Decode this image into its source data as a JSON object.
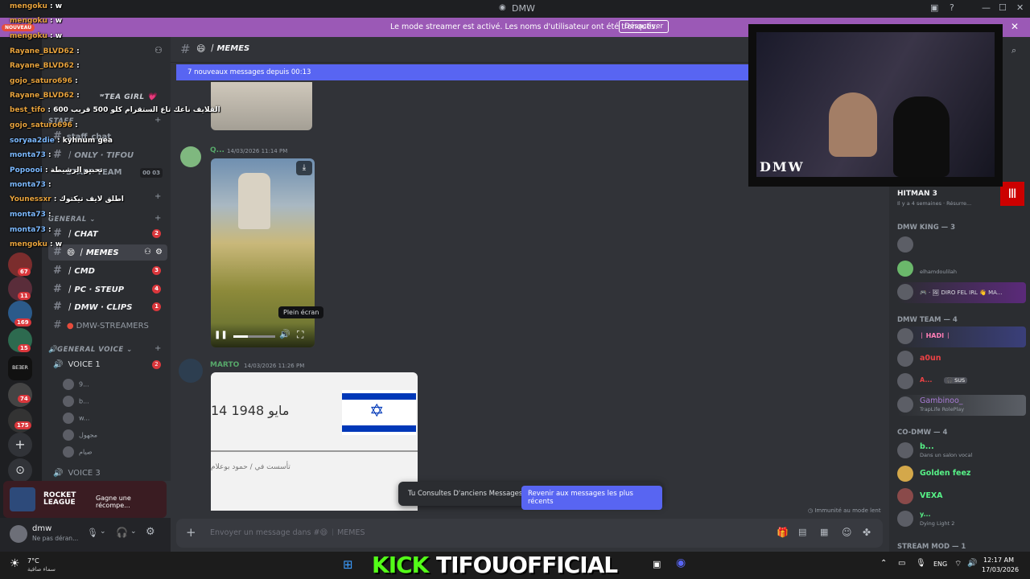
{
  "window": {
    "title": "DMW"
  },
  "banner": {
    "message": "Le mode streamer est activé. Les noms d'utilisateur ont été tronqués.",
    "button": "Désactiver",
    "nouveau": "NOUVEAU"
  },
  "channel": {
    "name": "ᛁ MEMES",
    "placeholder": "Envoyer un message dans #😄 ᛁ MEMES"
  },
  "newbar": {
    "text": "7 nouveaux messages depuis 00:13"
  },
  "messages": [
    {
      "author": "Q...",
      "time": "14/03/2026 11:14 PM",
      "tooltip": "Plein écran"
    },
    {
      "author": "MARTO",
      "time": "14/03/2026 11:26 PM",
      "flag_date": "14 مايو 1948",
      "flag_caption": "تأسست في / حمود بوعلام"
    }
  ],
  "jump": {
    "label": "Tu Consultes D'anciens Messages",
    "button": "Revenir aux messages les plus récents"
  },
  "slowmode": "Immunité au mode lent",
  "channels": {
    "cat_dw": "ʷTEA GIRL 💗",
    "staff": "STAFF",
    "staff_chat": "staff_chat",
    "only_tifou": "ᛁ ONLY · TIFOU",
    "staff_team": "STAFF TEAM",
    "team_nums": "00 03",
    "general": "GENERAL",
    "items": [
      {
        "name": "ᛁ CHAT",
        "badge": "2"
      },
      {
        "name": "ᛁ MEMES",
        "badge": ""
      },
      {
        "name": "ᛁ CMD",
        "badge": "3"
      },
      {
        "name": "ᛁ PC · STEUP",
        "badge": "4"
      },
      {
        "name": "ᛁ DMW · CLIPS",
        "badge": "1"
      },
      {
        "name": "DMW-STREAMERS",
        "badge": ""
      }
    ],
    "voice_cat": "GENERAL VOICE",
    "voice1": "VOICE 1",
    "voice1_badge": "2",
    "voice_users": [
      "9...",
      "b...",
      "w...",
      "مجهول",
      "صيام"
    ],
    "voice3": "VOICE 3"
  },
  "activity": {
    "game": "ROCKET LEAGUE",
    "text": "Gagne une récompe..."
  },
  "user": {
    "name": "dmw",
    "status": "Ne pas déran..."
  },
  "rail_badges": [
    "67",
    "11",
    "169",
    "15",
    "74",
    "175"
  ],
  "rail_label": "BEƎER",
  "members": {
    "game": {
      "name": "HITMAN 3",
      "status": "Il y a 4 semaines · Résurre..."
    },
    "groups": [
      {
        "title": "DMW KING — 3",
        "items": [
          {
            "name": "",
            "status": "",
            "color": "#f23f43"
          },
          {
            "name": "",
            "status": "elhamdoulilah",
            "color": "#f23f43"
          },
          {
            "name": "🎮 · 🖼 DIRO FEL IRL 👋 MA...",
            "status": "",
            "color": "#f0b232"
          }
        ]
      },
      {
        "title": "DMW TEAM — 4",
        "items": [
          {
            "name": "ᛁ HADI ᛁ",
            "status": "",
            "color": "#ff7eb6"
          },
          {
            "name": "a0un",
            "status": "",
            "color": "#ed4245"
          },
          {
            "name": "A...",
            "status": "🎧 SUS",
            "color": "#ed4245"
          },
          {
            "name": "Gambinoo_",
            "status": "TrapLife RolePlay",
            "color": "#a97bd6"
          }
        ]
      },
      {
        "title": "CO-DMW — 4",
        "items": [
          {
            "name": "b...",
            "status": "Dans un salon vocal",
            "color": "#57f287"
          },
          {
            "name": "Golden feez",
            "status": "",
            "color": "#57f287"
          },
          {
            "name": "VEXA",
            "status": "",
            "color": "#57f287"
          },
          {
            "name": "y...",
            "status": "Dying Light 2",
            "color": "#57f287"
          }
        ]
      },
      {
        "title": "STREAM MOD — 1",
        "items": []
      }
    ]
  },
  "overlay_chat": [
    {
      "user": "mengoku",
      "msg": "w"
    },
    {
      "user": "mengoku",
      "msg": "w"
    },
    {
      "user": "mengoku",
      "msg": "w"
    },
    {
      "user": "Rayane_BLVD62",
      "msg": ""
    },
    {
      "user": "Rayane_BLVD62",
      "msg": ""
    },
    {
      "user": "gojo_saturo696",
      "msg": ""
    },
    {
      "user": "Rayane_BLVD62",
      "msg": ""
    },
    {
      "user": "best_tifo",
      "msg": "القلايف ناعك تاع الستقرام كلو 500 قريب 600"
    },
    {
      "user": "gojo_saturo696",
      "msg": ""
    },
    {
      "user": "soryaa2die",
      "msg": "kyhnum gea"
    },
    {
      "user": "monta73",
      "msg": ""
    },
    {
      "user": "Popoooi",
      "msg": "تحبيو الرشيطة"
    },
    {
      "user": "monta73",
      "msg": ""
    },
    {
      "user": "Younessxr",
      "msg": "اطلق لايف تيكتوك"
    },
    {
      "user": "monta73",
      "msg": ""
    },
    {
      "user": "monta73",
      "msg": ""
    },
    {
      "user": "mengoku",
      "msg": "w"
    }
  ],
  "cam": {
    "logo": "DMW"
  },
  "taskbar": {
    "temp": "7°C",
    "weather": "سماء صافية",
    "kick": "KICK",
    "channel": "TIFOUOFFICIAL",
    "lang": "ENG",
    "time": "12:17 AM",
    "date": "17/03/2026"
  }
}
